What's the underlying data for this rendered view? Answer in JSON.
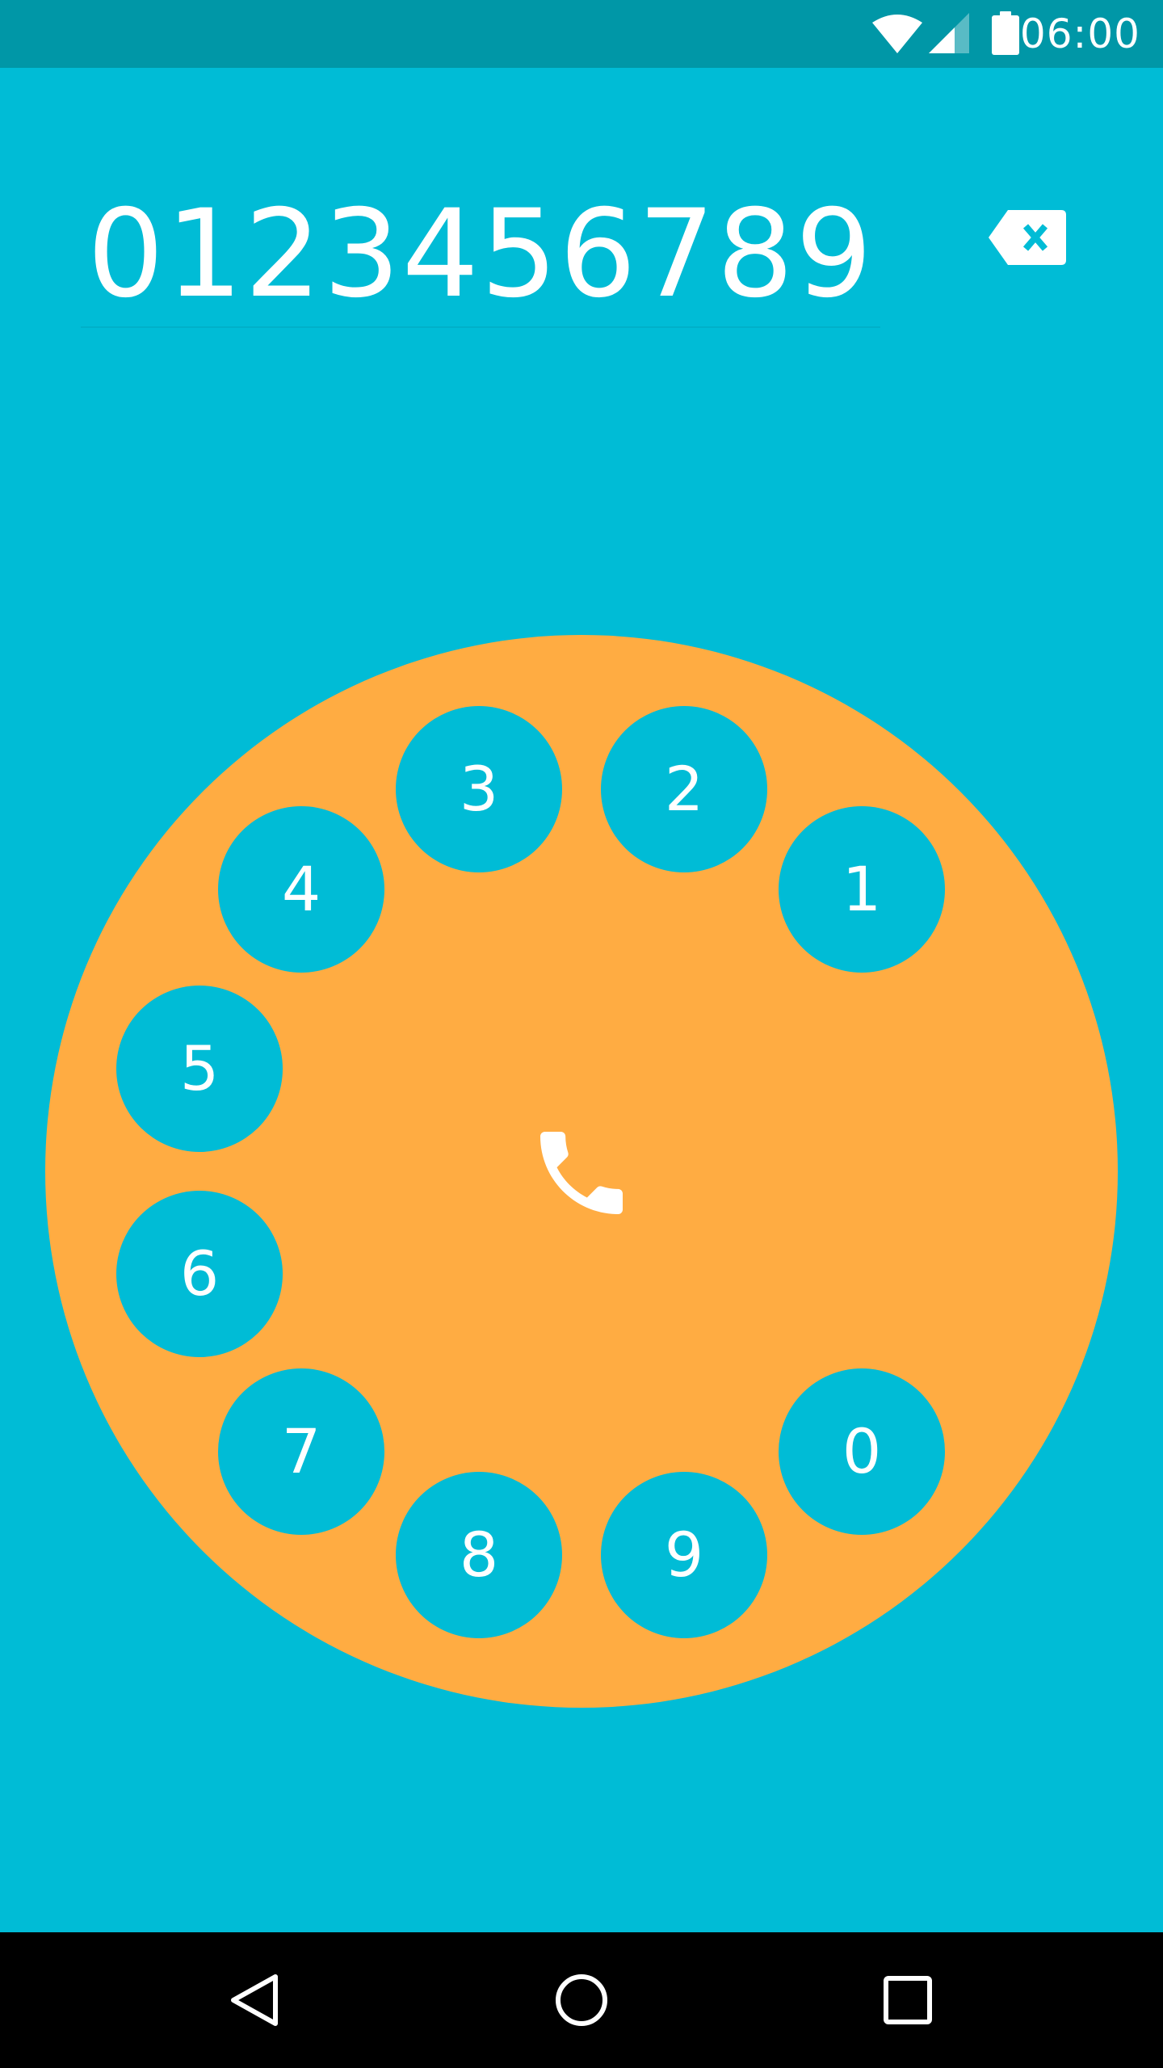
{
  "status_bar": {
    "time": "06:00",
    "icons": [
      "wifi-icon",
      "cell-signal-icon",
      "battery-icon"
    ]
  },
  "dialer": {
    "number": "0123456789",
    "backspace_icon": "backspace-icon"
  },
  "dial": {
    "keys": [
      {
        "label": "1"
      },
      {
        "label": "2"
      },
      {
        "label": "3"
      },
      {
        "label": "4"
      },
      {
        "label": "5"
      },
      {
        "label": "6"
      },
      {
        "label": "7"
      },
      {
        "label": "8"
      },
      {
        "label": "9"
      },
      {
        "label": "0"
      }
    ],
    "call_icon": "phone-icon"
  },
  "nav_bar": {
    "icons": [
      "back-icon",
      "home-icon",
      "recents-icon"
    ]
  },
  "colors": {
    "background": "#00BCD6",
    "status_bar": "#0097A7",
    "dial": "#FFAC42",
    "key": "#00BCD6",
    "text": "#FFFFFF",
    "nav_bar": "#000000"
  }
}
